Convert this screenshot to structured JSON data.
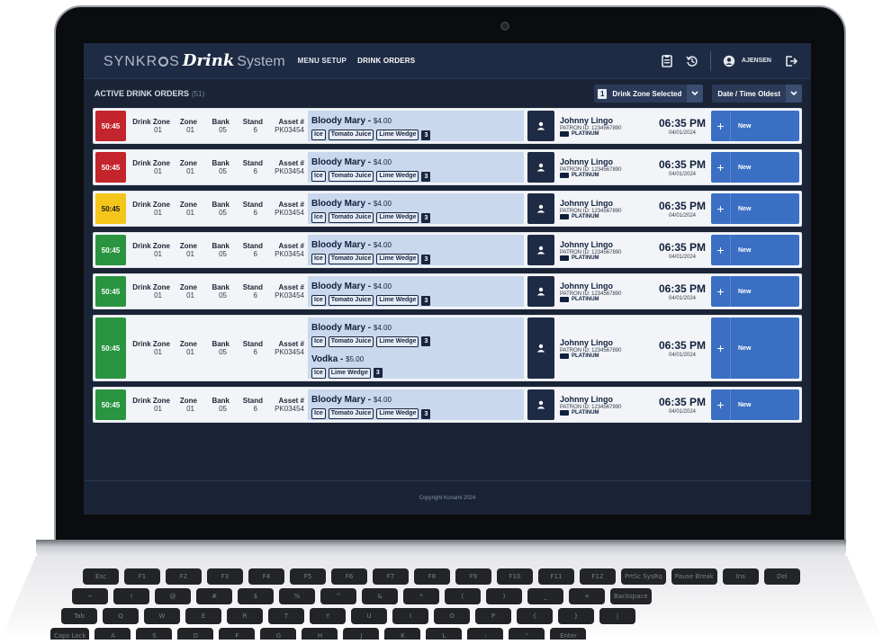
{
  "brand": {
    "part1": "SYNKR",
    "part1b": "S",
    "part2": "Drink",
    "part3": "System"
  },
  "nav": {
    "menu_setup": "MENU SETUP",
    "drink_orders": "DRINK ORDERS"
  },
  "user": {
    "name": "AJENSEN"
  },
  "subbar": {
    "title": "ACTIVE DRINK ORDERS",
    "count": "(51)",
    "zone_count": "1",
    "zone_label": "Drink Zone Selected",
    "sort_label": "Date / Time Oldest"
  },
  "headers": {
    "drink_zone": "Drink Zone",
    "zone": "Zone",
    "bank": "Bank",
    "stand": "Stand",
    "asset": "Asset #"
  },
  "colors": {
    "red": "#c4242b",
    "yellow": "#f4c51a",
    "green": "#2a9440",
    "status_blue": "#3b6fc4"
  },
  "orders": [
    {
      "timer": "50:45",
      "status_color": "red",
      "drink_zone": "01",
      "zone": "01",
      "bank": "05",
      "stand": "6",
      "asset": "PK03454",
      "drinks": [
        {
          "name": "Bloody Mary",
          "price": "$4.00",
          "mods": [
            "Ice",
            "Tomato Juice",
            "Lime Wedge"
          ],
          "count": "3"
        }
      ],
      "patron": {
        "name": "Johnny Lingo",
        "id": "PATRON ID: 1234567890",
        "tier": "PLATINUM"
      },
      "time": "06:35 PM",
      "date": "04/01/2024",
      "status": "New"
    },
    {
      "timer": "50:45",
      "status_color": "red",
      "drink_zone": "01",
      "zone": "01",
      "bank": "05",
      "stand": "6",
      "asset": "PK03454",
      "drinks": [
        {
          "name": "Bloody Mary",
          "price": "$4.00",
          "mods": [
            "Ice",
            "Tomato Juice",
            "Lime Wedge"
          ],
          "count": "3"
        }
      ],
      "patron": {
        "name": "Johnny Lingo",
        "id": "PATRON ID: 1234567890",
        "tier": "PLATINUM"
      },
      "time": "06:35 PM",
      "date": "04/01/2024",
      "status": "New"
    },
    {
      "timer": "50:45",
      "status_color": "yellow",
      "drink_zone": "01",
      "zone": "01",
      "bank": "05",
      "stand": "6",
      "asset": "PK03454",
      "drinks": [
        {
          "name": "Bloody Mary",
          "price": "$4.00",
          "mods": [
            "Ice",
            "Tomato Juice",
            "Lime Wedge"
          ],
          "count": "3"
        }
      ],
      "patron": {
        "name": "Johnny Lingo",
        "id": "PATRON ID: 1234567890",
        "tier": "PLATINUM"
      },
      "time": "06:35 PM",
      "date": "04/01/2024",
      "status": "New"
    },
    {
      "timer": "50:45",
      "status_color": "green",
      "drink_zone": "01",
      "zone": "01",
      "bank": "05",
      "stand": "6",
      "asset": "PK03454",
      "drinks": [
        {
          "name": "Bloody Mary",
          "price": "$4.00",
          "mods": [
            "Ice",
            "Tomato Juice",
            "Lime Wedge"
          ],
          "count": "3"
        }
      ],
      "patron": {
        "name": "Johnny Lingo",
        "id": "PATRON ID: 1234567890",
        "tier": "PLATINUM"
      },
      "time": "06:35 PM",
      "date": "04/01/2024",
      "status": "New"
    },
    {
      "timer": "50:45",
      "status_color": "green",
      "drink_zone": "01",
      "zone": "01",
      "bank": "05",
      "stand": "6",
      "asset": "PK03454",
      "drinks": [
        {
          "name": "Bloody Mary",
          "price": "$4.00",
          "mods": [
            "Ice",
            "Tomato Juice",
            "Lime Wedge"
          ],
          "count": "3"
        }
      ],
      "patron": {
        "name": "Johnny Lingo",
        "id": "PATRON ID: 1234567890",
        "tier": "PLATINUM"
      },
      "time": "06:35 PM",
      "date": "04/01/2024",
      "status": "New"
    },
    {
      "timer": "50:45",
      "status_color": "green",
      "drink_zone": "01",
      "zone": "01",
      "bank": "05",
      "stand": "6",
      "asset": "PK03454",
      "drinks": [
        {
          "name": "Bloody Mary",
          "price": "$4.00",
          "mods": [
            "Ice",
            "Tomato Juice",
            "Lime Wedge"
          ],
          "count": "3"
        },
        {
          "name": "Vodka",
          "price": "$5.00",
          "mods": [
            "Ice",
            "Lime Wedge"
          ],
          "count": "3"
        }
      ],
      "patron": {
        "name": "Johnny Lingo",
        "id": "PATRON ID: 1234567890",
        "tier": "PLATINUM"
      },
      "time": "06:35 PM",
      "date": "04/01/2024",
      "status": "New"
    },
    {
      "timer": "50:45",
      "status_color": "green",
      "drink_zone": "01",
      "zone": "01",
      "bank": "05",
      "stand": "6",
      "asset": "PK03454",
      "drinks": [
        {
          "name": "Bloody Mary",
          "price": "$4.00",
          "mods": [
            "Ice",
            "Tomato Juice",
            "Lime Wedge"
          ],
          "count": "3"
        }
      ],
      "patron": {
        "name": "Johnny Lingo",
        "id": "PATRON ID: 1234567890",
        "tier": "PLATINUM"
      },
      "time": "06:35 PM",
      "date": "04/01/2024",
      "status": "New"
    }
  ],
  "footer": {
    "copyright": "Copyright Konami 2024"
  },
  "keyboard": {
    "row1": [
      "Esc",
      "F1",
      "F2",
      "F3",
      "F4",
      "F5",
      "F6",
      "F7",
      "F8",
      "F9",
      "F10",
      "F11",
      "F12",
      "PrtSc SysRq",
      "Pause Break",
      "Ins",
      "Del"
    ],
    "row2": [
      "~",
      "!",
      "@",
      "#",
      "$",
      "%",
      "^",
      "&",
      "*",
      "(",
      ")",
      "_",
      "+",
      "Backspace"
    ],
    "row3": [
      "Tab",
      "Q",
      "W",
      "E",
      "R",
      "T",
      "Y",
      "U",
      "I",
      "O",
      "P",
      "{",
      "}",
      "|"
    ],
    "row4": [
      "Caps Lock",
      "A",
      "S",
      "D",
      "F",
      "G",
      "H",
      "J",
      "K",
      "L",
      ":",
      "\"",
      "Enter"
    ]
  }
}
